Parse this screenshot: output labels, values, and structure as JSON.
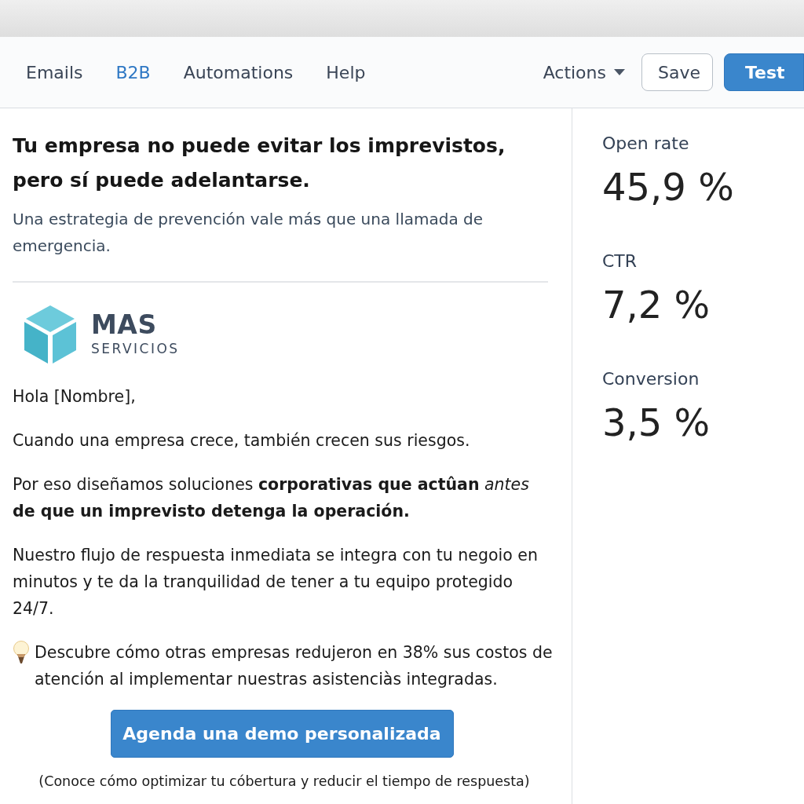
{
  "nav": {
    "tabs": [
      {
        "label": "Emails",
        "selected": false
      },
      {
        "label": "B2B",
        "selected": true
      },
      {
        "label": "Automations",
        "selected": false
      },
      {
        "label": "Help",
        "selected": false
      }
    ],
    "actions": {
      "label": "Actions"
    },
    "buttons": [
      {
        "label": "Save",
        "kind": "secondary"
      },
      {
        "label": "Test",
        "kind": "primary"
      }
    ]
  },
  "email": {
    "headline": "Tu empresa no puede evitar los imprevistos, pero sí puede adelantarse.",
    "subtitle": "Una estrategia de prevención vale más que una llamada de emergencia.",
    "logo": {
      "name": "MAS",
      "tagline": "SERVICIOS"
    },
    "greeting": "Hola [Nombre],",
    "paragraphs": [
      "Cuando una empresa crece, también crecen sus riesgos.",
      "Por eso diseñamos soluciones **corporativas que actûan** *antes* **de que un imprevisto detenga la operación.**",
      "Nuestro flujo de respuesta inmediata se integra con tu negoio en minutos y te da la tranquilidad de tener a tu equipo protegido 24/7."
    ],
    "tip": "Descubre cómo otras empresas redujeron en 38% sus costos de atención al implementar nuestras asistenciàs integradas.",
    "cta": "Agenda una demo personalizada",
    "note": "(Conoce cómo optimizar tu cóbertura y reducir el tiempo de respuesta)"
  },
  "metrics": [
    {
      "label": "Open rate",
      "value": "45,9 %"
    },
    {
      "label": "CTR",
      "value": "7,2 %"
    },
    {
      "label": "Conversion",
      "value": "3,5 %"
    }
  ]
}
